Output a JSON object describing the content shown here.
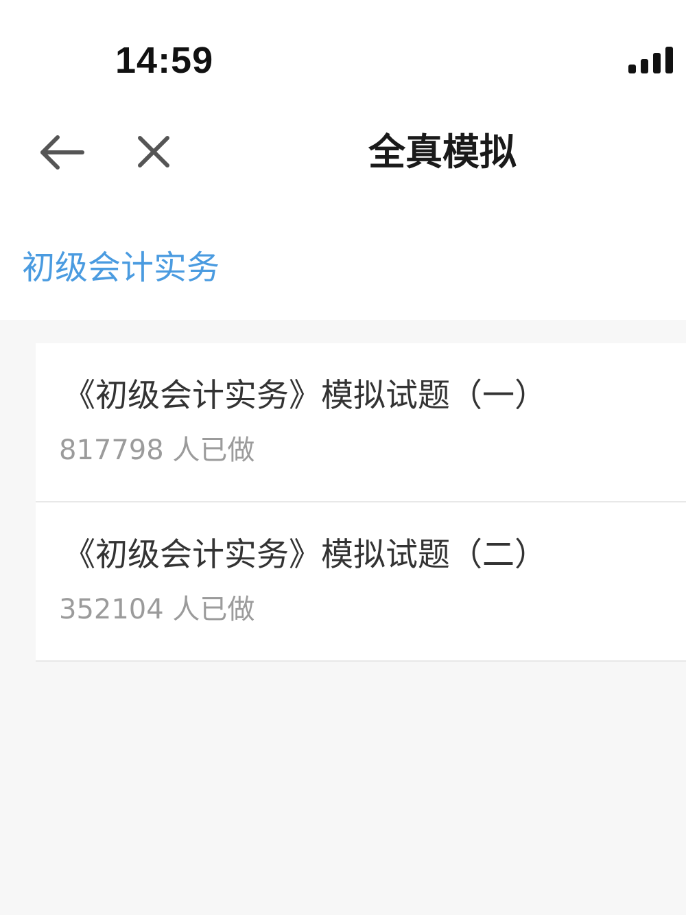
{
  "status_bar": {
    "time": "14:59",
    "signal_icon": "cellular-signal-icon"
  },
  "nav": {
    "back_icon": "arrow-left-icon",
    "close_icon": "close-icon",
    "title": "全真模拟"
  },
  "category": {
    "label": "初级会计实务"
  },
  "exams": [
    {
      "title": "《初级会计实务》模拟试题（一）",
      "count": "817798",
      "count_suffix": "人已做"
    },
    {
      "title": "《初级会计实务》模拟试题（二）",
      "count": "352104",
      "count_suffix": "人已做"
    }
  ],
  "colors": {
    "accent": "#4a9be0",
    "background": "#f7f7f7",
    "text_primary": "#333333",
    "text_secondary": "#9b9b9b"
  }
}
